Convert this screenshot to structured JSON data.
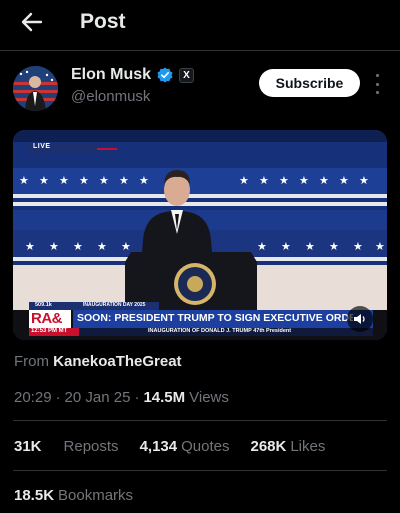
{
  "header": {
    "title": "Post"
  },
  "author": {
    "name": "Elon Musk",
    "handle": "@elonmusk",
    "badge_text": "X",
    "subscribe_label": "Subscribe"
  },
  "media": {
    "live_label": "LIVE",
    "network_logo": "RA&",
    "network_sub": "INAUGURATION DAY 2025",
    "chyron_small": "509.1k",
    "headline": "SOON: PRESIDENT TRUMP TO SIGN EXECUTIVE ORDE",
    "time": "12:53 PM MT",
    "ticker": "INAUGURATION OF DONALD J. TRUMP 47th President"
  },
  "source": {
    "from_label": "From",
    "from_account": "KanekoaTheGreat"
  },
  "meta": {
    "time": "20:29",
    "date": "20 Jan 25",
    "views_count": "14.5M",
    "views_label": "Views",
    "sep": "·"
  },
  "stats": {
    "reposts_count": "31K",
    "reposts_label": "Reposts",
    "quotes_count": "4,134",
    "quotes_label": "Quotes",
    "likes_count": "268K",
    "likes_label": "Likes",
    "bookmarks_count": "18.5K",
    "bookmarks_label": "Bookmarks"
  },
  "colors": {
    "accent_blue": "#1d9bf0",
    "muted": "#71767b",
    "text": "#e7e9ea"
  }
}
